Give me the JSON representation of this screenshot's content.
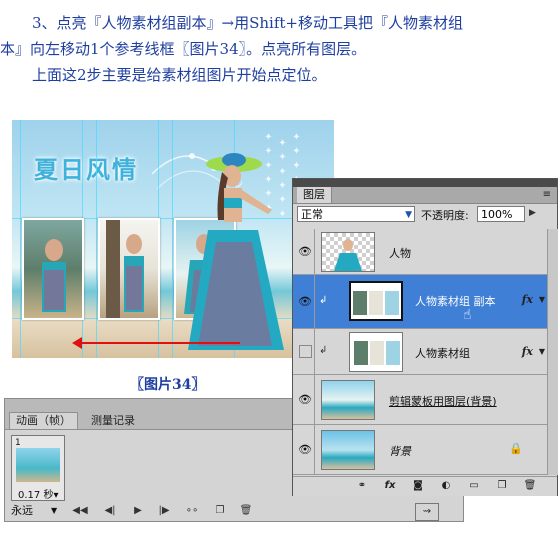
{
  "instructions": {
    "line1": "3、点亮『人物素材组副本』→用Shift+移动工具把『人物素材组",
    "line2": "本』向左移动1个参考线框〖图片34〗。点亮所有图层。",
    "line3": "上面这2步主要是给素材组图片开始点定位。"
  },
  "canvas": {
    "title": "夏日风情",
    "caption": "〖图片34〗"
  },
  "animation_panel": {
    "tabs": [
      "动画（帧）",
      "测量记录"
    ],
    "frame": {
      "number": "1",
      "delay": "0.17 秒▾"
    },
    "loop": "永远"
  },
  "layers_panel": {
    "tab": "图层",
    "blend_mode": "正常",
    "opacity_label": "不透明度:",
    "opacity_value": "100%",
    "layers": [
      {
        "name": "人物",
        "visible": true,
        "selected": false,
        "fx": false
      },
      {
        "name": "人物素材组 副本",
        "visible": true,
        "selected": true,
        "fx": true
      },
      {
        "name": "人物素材组",
        "visible": false,
        "selected": false,
        "fx": true
      },
      {
        "name": "剪辑蒙板用图层(背景)",
        "visible": true,
        "selected": false,
        "fx": false
      },
      {
        "name": "背景",
        "visible": true,
        "selected": false,
        "fx": false
      }
    ]
  },
  "colors": {
    "instruction_text": "#1f3fa0",
    "selected_layer": "#3f7fd6",
    "guide_line": "#4fd9ff",
    "arrow": "#e01010"
  }
}
